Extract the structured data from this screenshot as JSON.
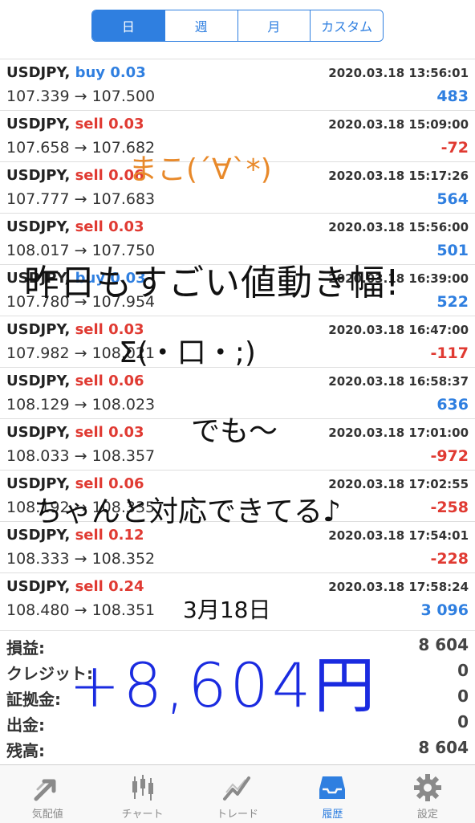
{
  "tabs": [
    {
      "label": "日",
      "active": true
    },
    {
      "label": "週",
      "active": false
    },
    {
      "label": "月",
      "active": false
    },
    {
      "label": "カスタム",
      "active": false
    }
  ],
  "trades": [
    {
      "symbol": "USDJPY,",
      "type": "buy",
      "volume": "0.03",
      "date": "2020.03.18 13:56:01",
      "open": "107.339",
      "close": "107.500",
      "profit": "483"
    },
    {
      "symbol": "USDJPY,",
      "type": "sell",
      "volume": "0.03",
      "date": "2020.03.18 15:09:00",
      "open": "107.658",
      "close": "107.682",
      "profit": "-72"
    },
    {
      "symbol": "USDJPY,",
      "type": "sell",
      "volume": "0.06",
      "date": "2020.03.18 15:17:26",
      "open": "107.777",
      "close": "107.683",
      "profit": "564"
    },
    {
      "symbol": "USDJPY,",
      "type": "sell",
      "volume": "0.03",
      "date": "2020.03.18 15:56:00",
      "open": "108.017",
      "close": "107.750",
      "profit": "501"
    },
    {
      "symbol": "USDJPY,",
      "type": "buy",
      "volume": "0.03",
      "date": "2020.03.18 16:39:00",
      "open": "107.780",
      "close": "107.954",
      "profit": "522"
    },
    {
      "symbol": "USDJPY,",
      "type": "sell",
      "volume": "0.03",
      "date": "2020.03.18 16:47:00",
      "open": "107.982",
      "close": "108.021",
      "profit": "-117"
    },
    {
      "symbol": "USDJPY,",
      "type": "sell",
      "volume": "0.06",
      "date": "2020.03.18 16:58:37",
      "open": "108.129",
      "close": "108.023",
      "profit": "636"
    },
    {
      "symbol": "USDJPY,",
      "type": "sell",
      "volume": "0.03",
      "date": "2020.03.18 17:01:00",
      "open": "108.033",
      "close": "108.357",
      "profit": "-972"
    },
    {
      "symbol": "USDJPY,",
      "type": "sell",
      "volume": "0.06",
      "date": "2020.03.18 17:02:55",
      "open": "108.192",
      "close": "108.335",
      "profit": "-258"
    },
    {
      "symbol": "USDJPY,",
      "type": "sell",
      "volume": "0.12",
      "date": "2020.03.18 17:54:01",
      "open": "108.333",
      "close": "108.352",
      "profit": "-228"
    },
    {
      "symbol": "USDJPY,",
      "type": "sell",
      "volume": "0.24",
      "date": "2020.03.18 17:58:24",
      "open": "108.480",
      "close": "108.351",
      "profit": "3 096"
    }
  ],
  "summary": [
    {
      "label": "損益:",
      "value": "8 604"
    },
    {
      "label": "クレジット:",
      "value": "0"
    },
    {
      "label": "証拠金:",
      "value": "0"
    },
    {
      "label": "出金:",
      "value": "0"
    },
    {
      "label": "残高:",
      "value": "8 604"
    }
  ],
  "bottom_tabs": [
    {
      "label": "気配値",
      "icon": "quotes-arrow-icon",
      "active": false
    },
    {
      "label": "チャート",
      "icon": "candlestick-chart-icon",
      "active": false
    },
    {
      "label": "トレード",
      "icon": "trade-line-icon",
      "active": false
    },
    {
      "label": "履歴",
      "icon": "history-tray-icon",
      "active": true
    },
    {
      "label": "設定",
      "icon": "gear-icon",
      "active": false
    }
  ],
  "handwriting": {
    "face": "まこ(´∀`*)",
    "line1": "昨日もすごい値動き幅!",
    "line2": "Σ(・口・;)",
    "line3": "でも〜",
    "line4": "ちゃんと対応できてる♪",
    "date": "3月18日",
    "total": "+8,604円"
  },
  "colors": {
    "accent": "#2f7fe0",
    "sell": "#e03a32",
    "orange": "#e8892a",
    "handblue": "#1a2be0"
  }
}
